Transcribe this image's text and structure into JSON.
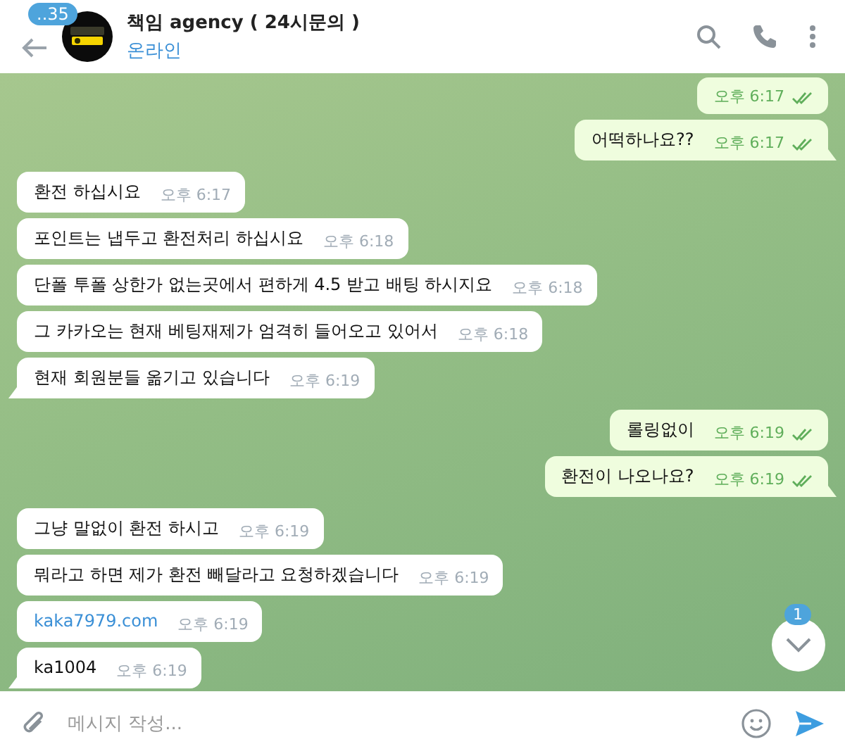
{
  "header": {
    "back_badge": "..35",
    "title": "책임 agency ( 24시문의 )",
    "status": "온라인"
  },
  "messages": [
    {
      "outgoing": true,
      "time": "오후 6:17",
      "read": true
    },
    {
      "outgoing": true,
      "kind": "text",
      "text": "어떡하나요??",
      "time": "오후 6:17",
      "read": true
    },
    {
      "outgoing": false,
      "kind": "text",
      "text": "환전 하십시요",
      "time": "오후 6:17"
    },
    {
      "outgoing": false,
      "kind": "text",
      "text": "포인트는 냅두고 환전처리 하십시요",
      "time": "오후 6:18"
    },
    {
      "outgoing": false,
      "kind": "text",
      "text": "단폴 투폴 상한가 없는곳에서 편하게 4.5 받고 배팅 하시지요",
      "time": "오후 6:18"
    },
    {
      "outgoing": false,
      "kind": "text",
      "text": "그 카카오는 현재 베팅재제가 엄격히 들어오고 있어서",
      "time": "오후 6:18"
    },
    {
      "outgoing": false,
      "kind": "text",
      "text": "현재 회원분들 옮기고 있습니다",
      "time": "오후 6:19"
    },
    {
      "outgoing": true,
      "kind": "text",
      "text": "롤링없이",
      "time": "오후 6:19",
      "read": true
    },
    {
      "outgoing": true,
      "kind": "text",
      "text": "환전이 나오나요?",
      "time": "오후 6:19",
      "read": true
    },
    {
      "outgoing": false,
      "kind": "text",
      "text": "그냥 말없이 환전 하시고",
      "time": "오후 6:19"
    },
    {
      "outgoing": false,
      "kind": "text",
      "text": "뭐라고 하면 제가 환전 빼달라고 요청하겠습니다",
      "time": "오후 6:19"
    },
    {
      "outgoing": false,
      "kind": "link",
      "text": "kaka7979.com",
      "time": "오후 6:19"
    },
    {
      "outgoing": false,
      "kind": "text",
      "text": "ka1004",
      "time": "오후 6:19"
    }
  ],
  "scroll_badge": "1",
  "composer": {
    "placeholder": "메시지 작성..."
  }
}
